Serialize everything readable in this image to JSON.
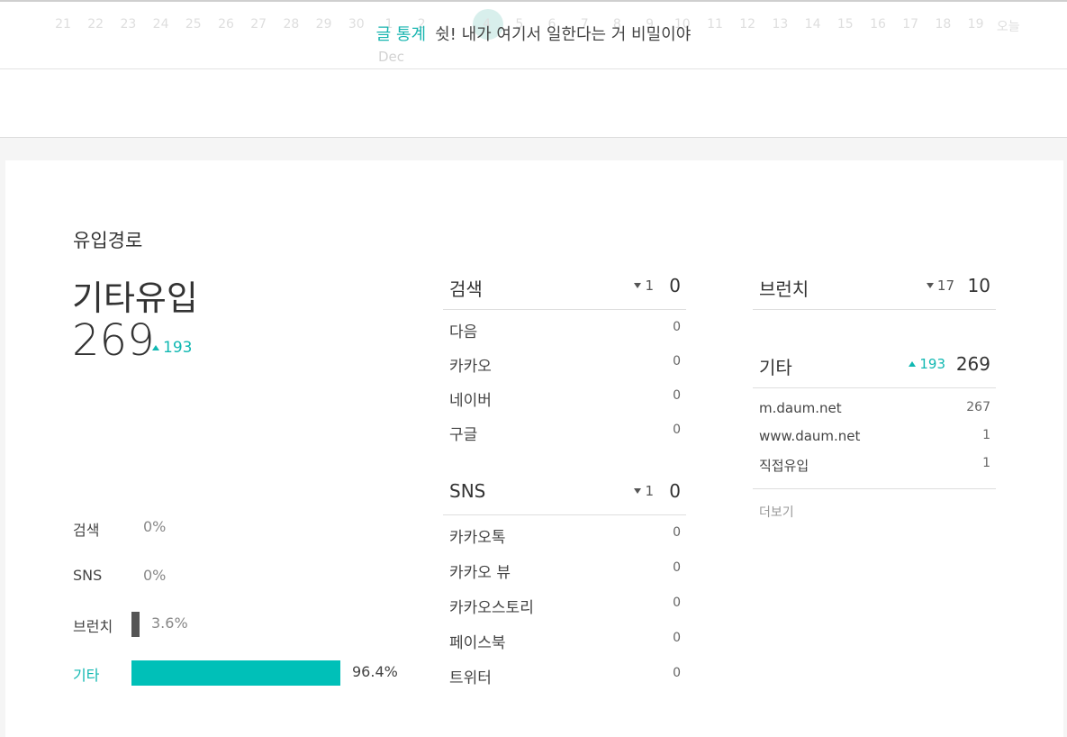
{
  "header": {
    "dates_before": [
      "21",
      "22",
      "23",
      "24",
      "25",
      "26",
      "27",
      "28",
      "29",
      "30",
      "1",
      "2"
    ],
    "dates_after": [
      "4",
      "5",
      "6",
      "7",
      "8",
      "9",
      "10",
      "11",
      "12",
      "13",
      "14",
      "15",
      "16",
      "17",
      "18",
      "19",
      "오늘"
    ],
    "month": "Dec",
    "title_accent": "글 통계",
    "title_text": "쉿! 내가 여기서 일한다는 거 비밀이야"
  },
  "inflow": {
    "section_title": "유입경로",
    "selected_label": "기타유입",
    "selected_value": "269",
    "selected_delta": "193",
    "distribution": [
      {
        "label": "검색",
        "percent": 0,
        "percent_text": "0%"
      },
      {
        "label": "SNS",
        "percent": 0,
        "percent_text": "0%"
      },
      {
        "label": "브런치",
        "percent": 3.6,
        "percent_text": "3.6%"
      },
      {
        "label": "기타",
        "percent": 96.4,
        "percent_text": "96.4%"
      }
    ]
  },
  "groups": {
    "search": {
      "label": "검색",
      "delta": "1",
      "total": "0",
      "rows": [
        {
          "label": "다음",
          "value": "0"
        },
        {
          "label": "카카오",
          "value": "0"
        },
        {
          "label": "네이버",
          "value": "0"
        },
        {
          "label": "구글",
          "value": "0"
        }
      ]
    },
    "sns": {
      "label": "SNS",
      "delta": "1",
      "total": "0",
      "rows": [
        {
          "label": "카카오톡",
          "value": "0"
        },
        {
          "label": "카카오 뷰",
          "value": "0"
        },
        {
          "label": "카카오스토리",
          "value": "0"
        },
        {
          "label": "페이스북",
          "value": "0"
        },
        {
          "label": "트위터",
          "value": "0"
        }
      ]
    },
    "brunch": {
      "label": "브런치",
      "delta": "17",
      "total": "10"
    },
    "etc": {
      "label": "기타",
      "delta": "193",
      "total": "269",
      "rows": [
        {
          "label": "m.daum.net",
          "value": "267"
        },
        {
          "label": "www.daum.net",
          "value": "1"
        },
        {
          "label": "직접유입",
          "value": "1"
        }
      ],
      "more_label": "더보기"
    }
  },
  "colors": {
    "accent": "#11b8b2",
    "bar_dark": "#555555",
    "bar_accent": "#00c0b8"
  }
}
